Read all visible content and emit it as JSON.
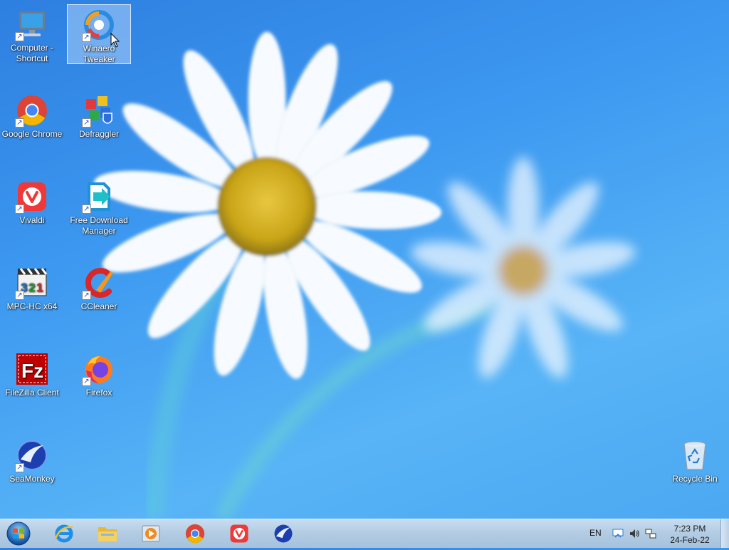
{
  "desktop": {
    "icons": [
      {
        "label": "Computer - Shortcut",
        "icon": "computer-icon"
      },
      {
        "label": "Winaero Tweaker",
        "icon": "winaero-tweaker-icon"
      },
      {
        "label": "Google Chrome",
        "icon": "chrome-icon"
      },
      {
        "label": "Defraggler",
        "icon": "defraggler-icon"
      },
      {
        "label": "Vivaldi",
        "icon": "vivaldi-icon"
      },
      {
        "label": "Free Download Manager",
        "icon": "fdm-icon"
      },
      {
        "label": "MPC-HC x64",
        "icon": "mpc-hc-icon"
      },
      {
        "label": "CCleaner",
        "icon": "ccleaner-icon"
      },
      {
        "label": "FileZilla Client",
        "icon": "filezilla-icon"
      },
      {
        "label": "Firefox",
        "icon": "firefox-icon"
      },
      {
        "label": "SeaMonkey",
        "icon": "seamonkey-icon"
      },
      {
        "label": "Recycle Bin",
        "icon": "recycle-bin-icon"
      }
    ],
    "selected": "Winaero Tweaker"
  },
  "taskbar": {
    "pinned": [
      "internet-explorer-icon",
      "file-explorer-icon",
      "media-player-icon",
      "chrome-icon",
      "vivaldi-icon",
      "seamonkey-icon"
    ],
    "language": "EN",
    "clock": {
      "time": "7:23 PM",
      "date": "24-Feb-22"
    }
  },
  "colors": {
    "taskbar": "#b4cde4",
    "desktop": "#3c98f0",
    "selection": "#c8e1ff"
  }
}
